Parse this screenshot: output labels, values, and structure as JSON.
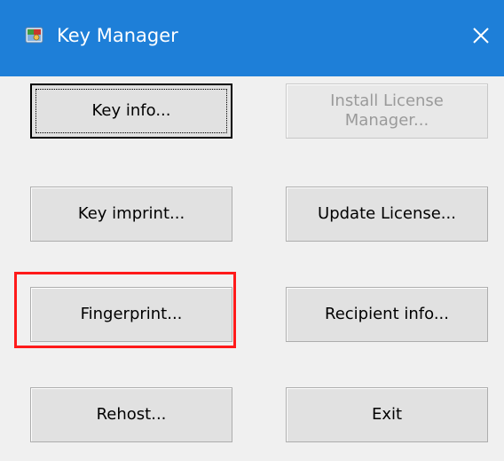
{
  "window": {
    "title": "Key Manager",
    "icon": "key-manager-app-icon",
    "close_icon": "close-icon"
  },
  "buttons": {
    "key_info": "Key info...",
    "install_license_manager": "Install License\nManager...",
    "key_imprint": "Key imprint...",
    "update_license": "Update License...",
    "fingerprint": "Fingerprint...",
    "recipient_info": "Recipient info...",
    "rehost": "Rehost...",
    "exit": "Exit"
  },
  "states": {
    "default_button": "Key info...",
    "disabled_buttons": [
      "Install License\nManager..."
    ],
    "highlighted_button": "Fingerprint..."
  },
  "colors": {
    "titlebar": "#1e7fd8",
    "highlight": "#ff1a1a",
    "background": "#f0f0f0"
  }
}
